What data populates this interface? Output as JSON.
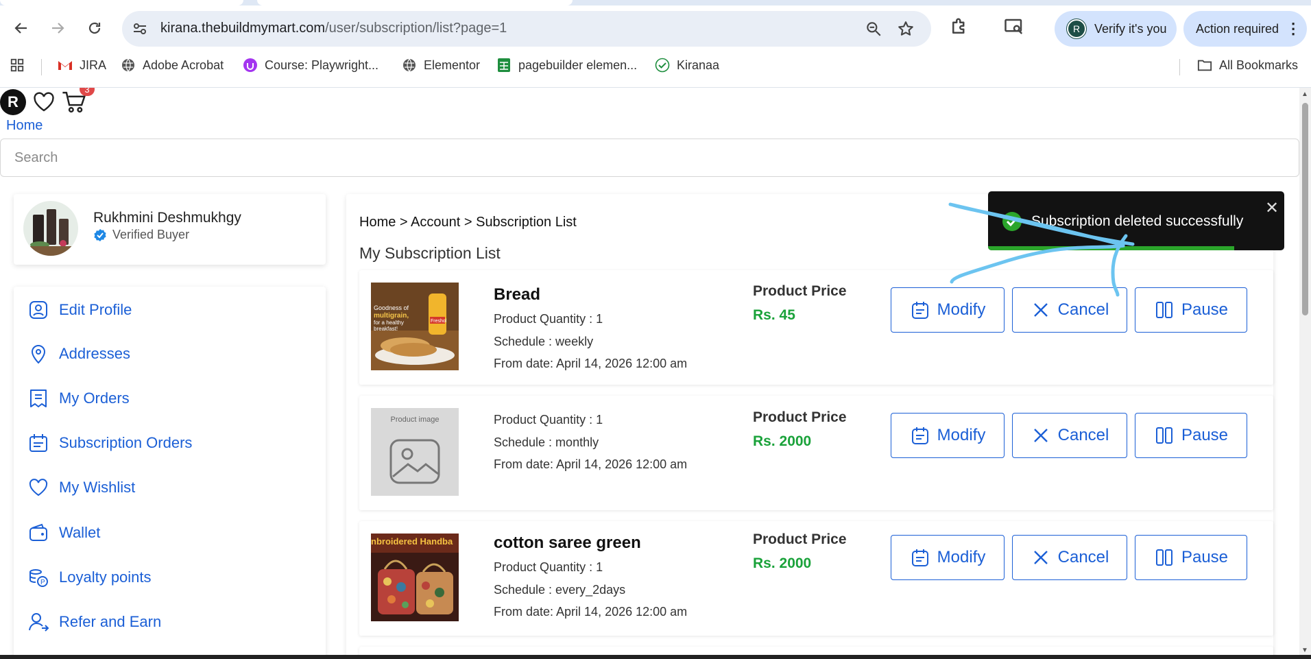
{
  "browser": {
    "url_host": "kirana.thebuildmymart.com",
    "url_path": "/user/subscription/list?page=1",
    "verify_label": "Verify it's you",
    "verify_avatar": "R",
    "action_label": "Action required",
    "all_bookmarks_label": "All Bookmarks",
    "bookmarks": [
      {
        "label": "JIRA",
        "icon": "gmail-icon"
      },
      {
        "label": "Adobe Acrobat",
        "icon": "globe-icon"
      },
      {
        "label": "Course: Playwright...",
        "icon": "udemy-icon"
      },
      {
        "label": "Elementor",
        "icon": "globe-icon"
      },
      {
        "label": "pagebuilder elemen...",
        "icon": "sheets-icon"
      },
      {
        "label": "Kiranaa",
        "icon": "check-icon"
      }
    ]
  },
  "header": {
    "avatar_letter": "R",
    "cart_count": "3",
    "home_link": "Home",
    "search_placeholder": "Search"
  },
  "profile": {
    "name": "Rukhmini Deshmukhgy",
    "badge": "Verified Buyer"
  },
  "menu": [
    {
      "label": "Edit Profile",
      "icon": "user-icon"
    },
    {
      "label": "Addresses",
      "icon": "location-icon"
    },
    {
      "label": "My Orders",
      "icon": "orders-icon"
    },
    {
      "label": "Subscription Orders",
      "icon": "calendar-icon"
    },
    {
      "label": "My Wishlist",
      "icon": "heart-icon"
    },
    {
      "label": "Wallet",
      "icon": "wallet-icon"
    },
    {
      "label": "Loyalty points",
      "icon": "coins-icon"
    },
    {
      "label": "Refer and Earn",
      "icon": "refer-icon"
    }
  ],
  "content": {
    "breadcrumb": "Home > Account > Subscription List",
    "title": "My Subscription List",
    "price_label": "Product Price",
    "buttons": {
      "modify": "Modify",
      "cancel": "Cancel",
      "pause": "Pause"
    },
    "subscriptions": [
      {
        "name": "Bread",
        "quantity": "Product Quantity : 1",
        "schedule": "Schedule : weekly",
        "from_date": "From date: April 14, 2026 12:00 am",
        "price": "Rs. 45",
        "image_text_1": "Goodness of",
        "image_text_2": "multigrain,",
        "image_text_3": "for a healthy",
        "image_text_4": "breakfast!",
        "image_brand": "Freshol"
      },
      {
        "name": "",
        "quantity": "Product Quantity : 1",
        "schedule": "Schedule : monthly",
        "from_date": "From date: April 14, 2026 12:00 am",
        "price": "Rs. 2000",
        "image_placeholder": "Product image"
      },
      {
        "name": "cotton saree green",
        "quantity": "Product Quantity : 1",
        "schedule": "Schedule : every_2days",
        "from_date": "From date: April 14, 2026 12:00 am",
        "price": "Rs. 2000",
        "image_text_1": "nbroidered Handba"
      }
    ]
  },
  "toast": {
    "message": "Subscription deleted successfully",
    "close": "✕",
    "progress": 0.83
  },
  "colors": {
    "link_blue": "#1b5fd6",
    "price_green": "#1aa23a",
    "toast_bg": "#121212",
    "toast_progress": "#2ba52b",
    "annotation": "#6cc4f0"
  }
}
